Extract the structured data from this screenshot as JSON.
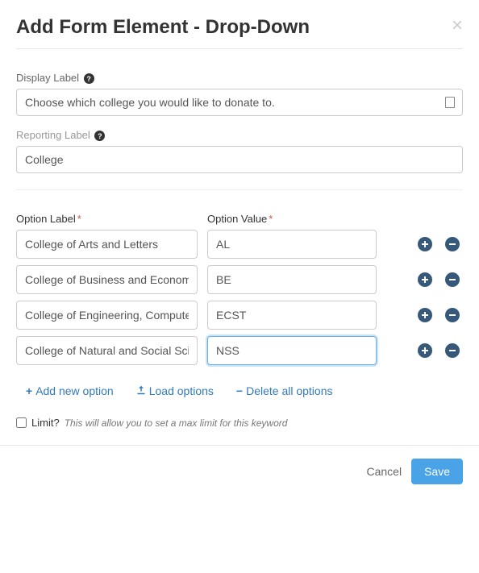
{
  "header": {
    "title": "Add Form Element - Drop-Down"
  },
  "form": {
    "display_label": {
      "label": "Display Label",
      "value": "Choose which college you would like to donate to."
    },
    "reporting_label": {
      "label": "Reporting Label",
      "value": "College"
    }
  },
  "options_section": {
    "label_header": "Option Label",
    "value_header": "Option Value",
    "rows": [
      {
        "label": "College of Arts and Letters",
        "value": "AL"
      },
      {
        "label": "College of Business and Economics",
        "value": "BE"
      },
      {
        "label": "College of Engineering, Computer Science",
        "value": "ECST"
      },
      {
        "label": "College of Natural and Social Sciences",
        "value": "NSS"
      }
    ],
    "actions": {
      "add_new": "Add new option",
      "load": "Load options",
      "delete_all": "Delete all options"
    }
  },
  "limit": {
    "label": "Limit?",
    "hint": "This will allow you to set a max limit for this keyword"
  },
  "footer": {
    "cancel": "Cancel",
    "save": "Save"
  }
}
